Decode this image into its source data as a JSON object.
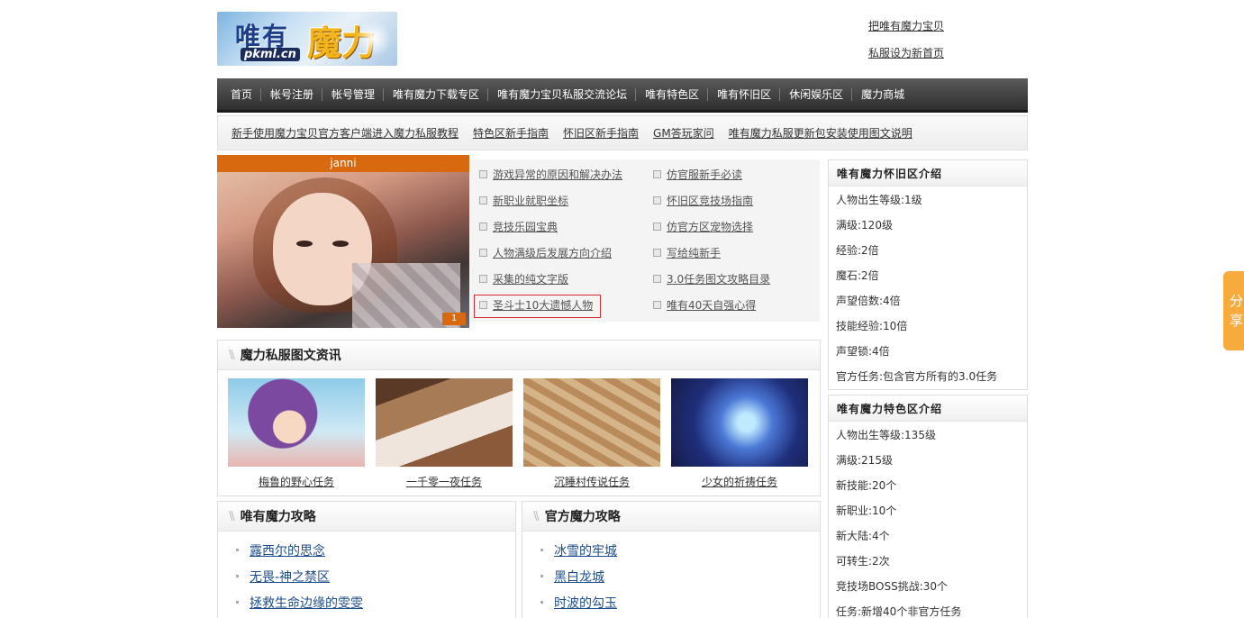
{
  "site": {
    "logo_text_1": "唯有",
    "logo_text_2": "魔力",
    "logo_domain": "pkml.cn"
  },
  "toplinks": [
    "把唯有魔力宝贝",
    "私服设为新首页"
  ],
  "nav": [
    "首页",
    "帐号注册",
    "帐号管理",
    "唯有魔力下载专区",
    "唯有魔力宝贝私服交流论坛",
    "唯有特色区",
    "唯有怀旧区",
    "休闲娱乐区",
    "魔力商城"
  ],
  "subnav": [
    "新手使用魔力宝贝官方客户端进入魔力私服教程",
    "特色区新手指南",
    "怀旧区新手指南",
    "GM答玩家问",
    "唯有魔力私服更新包安装使用图文说明"
  ],
  "feature": {
    "caption": "janni",
    "badge": "1"
  },
  "articles": [
    "游戏异常的原因和解决办法",
    "仿官服新手必读",
    "新职业就职坐标",
    "怀旧区竞技场指南",
    "竞技乐园宝典",
    "仿官方区宠物选择",
    "人物满级后发展方向介绍",
    "写给纯新手",
    "采集的纯文字版",
    "3.0任务图文攻略目录",
    "圣斗士10大遗憾人物",
    "唯有40天自强心得"
  ],
  "news": {
    "title": "魔力私服图文资讯",
    "items": [
      "梅鲁的野心任务",
      "一千零一夜任务",
      "沉睡村传说任务",
      "少女的祈祷任务"
    ]
  },
  "guide1": {
    "title": "唯有魔力攻略",
    "items": [
      "露西尔的思念",
      "无畏-神之禁区",
      "拯救生命边缘的雯雯"
    ]
  },
  "guide2": {
    "title": "官方魔力攻略",
    "items": [
      "冰雪的牢城",
      "黑白龙城",
      "时波的勾玉"
    ]
  },
  "side1": {
    "title": "唯有魔力怀旧区介绍",
    "items": [
      "人物出生等级:1级",
      "满级:120级",
      "经验:2倍",
      "魔石:2倍",
      "声望倍数:4倍",
      "技能经验:10倍",
      "声望锁:4倍",
      "官方任务:包含官方所有的3.0任务"
    ]
  },
  "side2": {
    "title": "唯有魔力特色区介绍",
    "items": [
      "人物出生等级:135级",
      "满级:215级",
      "新技能:20个",
      "新职业:10个",
      "新大陆:4个",
      "可转生:2次",
      "竞技场BOSS挑战:30个",
      "任务:新增40个非官方任务"
    ]
  },
  "share": "分享",
  "colors": {
    "nav_bg": "#3c3c3c",
    "feature_caption": "#d9690f",
    "link_blue": "#1c4d8a",
    "share": "#f6ab3c",
    "highlight_border": "#d32c2c"
  }
}
